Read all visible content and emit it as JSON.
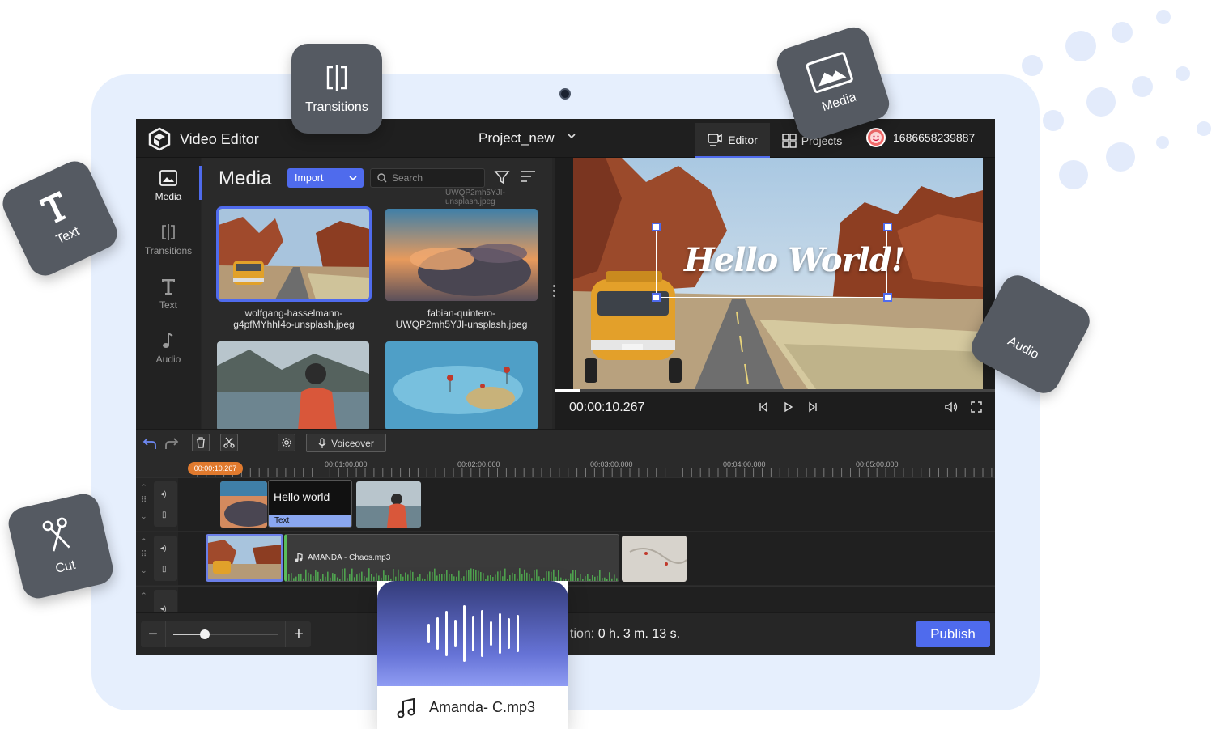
{
  "app": {
    "title": "Video Editor",
    "project_name": "Project_new",
    "tabs": [
      {
        "label": "Editor",
        "icon": "editor-icon",
        "active": true
      },
      {
        "label": "Projects",
        "icon": "grid-icon",
        "active": false
      }
    ],
    "user_id": "1686658239887"
  },
  "sidebar": {
    "items": [
      {
        "label": "Media",
        "icon": "image-icon",
        "active": true
      },
      {
        "label": "Transitions",
        "icon": "transitions-icon",
        "active": false
      },
      {
        "label": "Text",
        "icon": "text-icon",
        "active": false
      },
      {
        "label": "Audio",
        "icon": "music-note-icon",
        "active": false
      }
    ]
  },
  "media": {
    "title": "Media",
    "import_label": "Import",
    "search_placeholder": "Search",
    "cut_filename": "UWQP2mh5YJI-unsplash.jpeg",
    "items": [
      {
        "caption_line1": "wolfgang-hasselmann-",
        "caption_line2": "g4pfMYhhI4o-unsplash.jpeg",
        "selected": true
      },
      {
        "caption_line1": "fabian-quintero-",
        "caption_line2": "UWQP2mh5YJI-unsplash.jpeg",
        "selected": false
      },
      {
        "caption_line1": "",
        "caption_line2": "",
        "selected": false
      },
      {
        "caption_line1": "",
        "caption_line2": "",
        "selected": false
      }
    ]
  },
  "preview": {
    "overlay_text": "Hello World!",
    "current_time": "00:00:10.267",
    "progress_fraction": 0.055
  },
  "timeline": {
    "voiceover_label": "Voiceover",
    "playhead_time": "00:00:10.267",
    "ruler_labels": [
      "00:01:00.000",
      "00:02:00.000",
      "00:03:00.000",
      "00:04:00.000",
      "00:05:00.000"
    ],
    "text_clip": {
      "label": "Hello world",
      "tag": "Text"
    },
    "audio_clip": {
      "label": "AMANDA - Chaos.mp3"
    },
    "duration_prefix": "tion:",
    "duration_value": "0 h. 3 m. 13 s.",
    "publish_label": "Publish",
    "zoom_minus": "−",
    "zoom_plus": "+",
    "zoom_level": 0.3
  },
  "floating_tiles": {
    "transitions": "Transitions",
    "media": "Media",
    "text": "Text",
    "audio": "Audio",
    "cut": "Cut"
  },
  "audio_card": {
    "filename": "Amanda- C.mp3"
  },
  "colors": {
    "accent": "#4f6bed",
    "playhead": "#e07a2e",
    "audio_wave": "#5bbd5b",
    "tablet_bg": "#e6effd",
    "tile_bg": "#555a62"
  }
}
